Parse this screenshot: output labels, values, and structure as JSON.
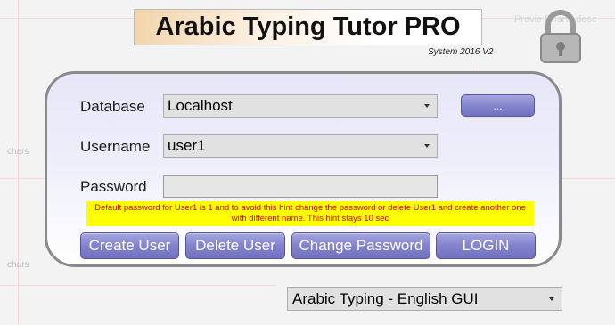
{
  "app": {
    "title": "Arabic Typing Tutor PRO",
    "version": "System 2016 V2",
    "background_ghost_text": "Previe     Pharts desc"
  },
  "background": {
    "chip_1": "chars",
    "chip_2": "chars"
  },
  "login": {
    "database_label": "Database",
    "database_value": "Localhost",
    "browse_button": "...",
    "username_label": "Username",
    "username_value": "user1",
    "password_label": "Password",
    "password_value": "",
    "hint": "Default password for User1 is 1 and to avoid this hint change the password or delete User1 and create another one with different name. This hint stays 10 sec",
    "buttons": {
      "create": "Create User",
      "delete": "Delete User",
      "change_password": "Change Password",
      "login": "LOGIN"
    }
  },
  "language": {
    "selected": "Arabic Typing - English GUI"
  },
  "icons": {
    "lock": "padlock-icon"
  },
  "colors": {
    "button": "#8282cc",
    "hint_bg": "#ffff00",
    "hint_text": "#d10000",
    "panel_border": "#8a8a8a"
  }
}
